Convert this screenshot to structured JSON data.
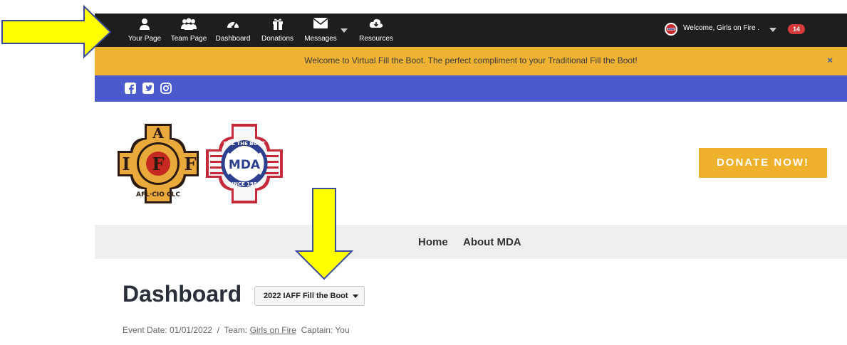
{
  "topnav": {
    "items": [
      {
        "label": "Your Page",
        "icon": "user-icon"
      },
      {
        "label": "Team Page",
        "icon": "team-icon"
      },
      {
        "label": "Dashboard",
        "icon": "dashboard-icon"
      },
      {
        "label": "Donations",
        "icon": "gift-icon"
      },
      {
        "label": "Messages",
        "icon": "envelope-icon"
      },
      {
        "label": "Resources",
        "icon": "cloud-download-icon"
      }
    ],
    "welcome": "Welcome, Girls on Fire .",
    "notification_count": "14"
  },
  "banner": {
    "text": "Welcome to Virtual Fill the Boot.  The perfect compliment to your Traditional Fill the Boot!",
    "close": "×"
  },
  "social": [
    "facebook-icon",
    "twitter-icon",
    "instagram-icon"
  ],
  "logos": {
    "iaff": {
      "top": "A",
      "letters": [
        "I",
        "F",
        "F"
      ],
      "bottom": "AFL·CIO CLC"
    },
    "mda": {
      "top": "FILL THE BOOT",
      "center": "MDA",
      "bottom": "SINCE 1954"
    }
  },
  "donate_label": "DONATE NOW!",
  "menu": {
    "home": "Home",
    "about": "About MDA"
  },
  "dashboard": {
    "title": "Dashboard",
    "event_select": "2022 IAFF Fill the Boot",
    "event_date_label": "Event Date: 01/01/2022  /  Team: ",
    "team_name": "Girls on Fire",
    "captain_label": "  Captain: You"
  },
  "colors": {
    "topbar": "#1e1e1e",
    "banner": "#f0b232",
    "social_bar": "#4b5bcd",
    "donate": "#efb02c",
    "badge": "#d63a3a",
    "arrow_fill": "#ffff00",
    "arrow_stroke": "#3b4a9a"
  }
}
